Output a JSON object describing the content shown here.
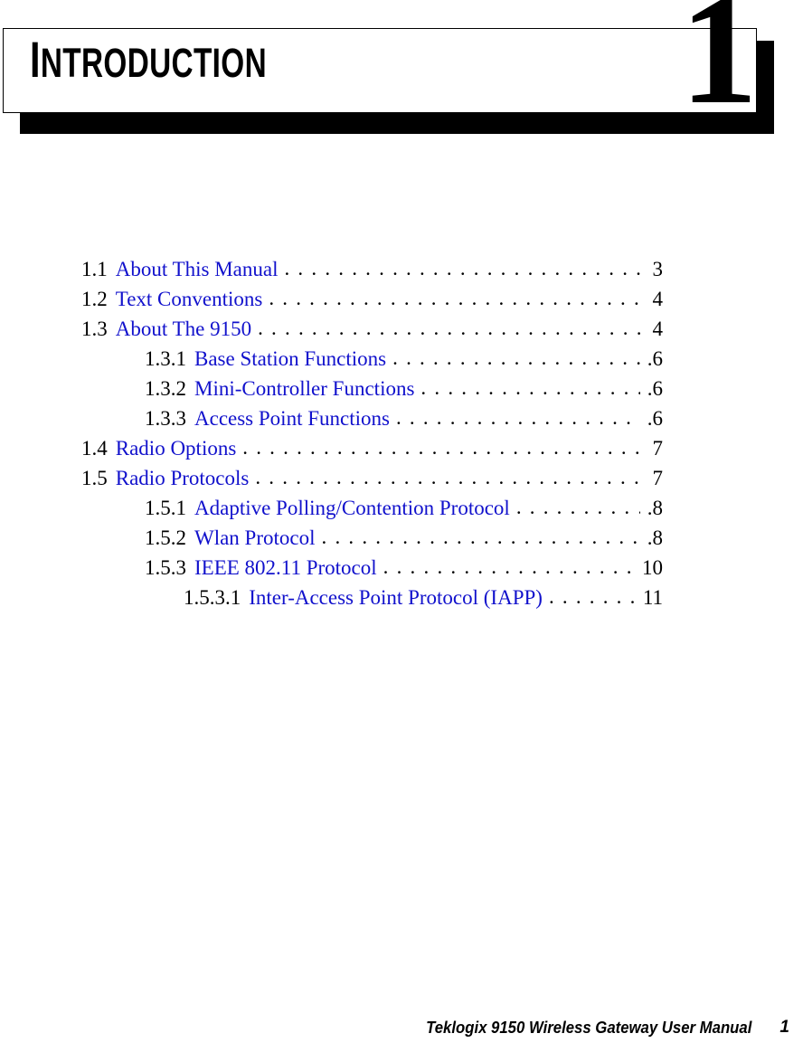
{
  "chapter": {
    "title": "INTRODUCTION",
    "title_first_letter": "I",
    "title_rest": "NTRODUCTION",
    "number": "1"
  },
  "toc": {
    "entries": [
      {
        "level": 1,
        "number": "1.1",
        "title": "About This Manual",
        "page": "3"
      },
      {
        "level": 1,
        "number": "1.2",
        "title": "Text Conventions",
        "page": "4"
      },
      {
        "level": 1,
        "number": "1.3",
        "title": "About The 9150",
        "page": "4"
      },
      {
        "level": 2,
        "number": "1.3.1",
        "title": "Base Station Functions",
        "page": ".6"
      },
      {
        "level": 2,
        "number": "1.3.2",
        "title": "Mini-Controller Functions",
        "page": ".6"
      },
      {
        "level": 2,
        "number": "1.3.3",
        "title": "Access Point Functions",
        "page": ".6"
      },
      {
        "level": 1,
        "number": "1.4",
        "title": "Radio Options",
        "page": "7"
      },
      {
        "level": 1,
        "number": "1.5",
        "title": "Radio Protocols",
        "page": "7"
      },
      {
        "level": 2,
        "number": "1.5.1",
        "title": "Adaptive Polling/Contention Protocol",
        "page": ".8"
      },
      {
        "level": 2,
        "number": "1.5.2",
        "title": "Wlan Protocol",
        "page": ".8"
      },
      {
        "level": 2,
        "number": "1.5.3",
        "title": "IEEE 802.11 Protocol",
        "page": "10"
      },
      {
        "level": 3,
        "number": "1.5.3.1",
        "title": "Inter-Access Point Protocol (IAPP)",
        "page": "11"
      }
    ],
    "leader_character": "."
  },
  "footer": {
    "manual_title": "Teklogix 9150 Wireless Gateway User Manual",
    "page_number": "1"
  },
  "colors": {
    "link_blue": "#1111cc",
    "text_black": "#000000",
    "page_background": "#ffffff"
  }
}
